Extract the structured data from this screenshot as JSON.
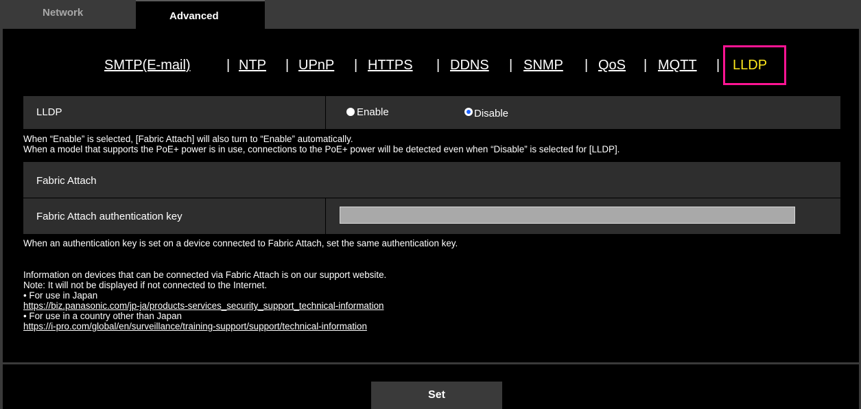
{
  "tabs": {
    "network": "Network",
    "advanced": "Advanced"
  },
  "subnav": {
    "items": [
      "SMTP(E-mail)",
      "NTP",
      "UPnP",
      "HTTPS",
      "DDNS",
      "SNMP",
      "QoS",
      "MQTT",
      "LLDP"
    ],
    "separator": "|",
    "active": "LLDP"
  },
  "lldp": {
    "label": "LLDP",
    "enable": "Enable",
    "disable": "Disable",
    "selected": "Disable"
  },
  "notes": {
    "line1": "When “Enable” is selected, [Fabric Attach] will also turn to “Enable” automatically.",
    "line2": "When a model that supports the PoE+ power is in use, connections to the PoE+ power will be detected even when “Disable” is selected for [LLDP]."
  },
  "fabric": {
    "section_title": "Fabric Attach",
    "key_label": "Fabric Attach authentication key",
    "key_value": "",
    "key_note": "When an authentication key is set on a device connected to Fabric Attach, set the same authentication key."
  },
  "info": {
    "line1": "Information on devices that can be connected via Fabric Attach is on our support website.",
    "line2": "Note: It will not be displayed if not connected to the Internet.",
    "japan_label": "• For use in Japan",
    "japan_url": "https://biz.panasonic.com/jp-ja/products-services_security_support_technical-information",
    "other_label": "• For use in a country other than Japan",
    "other_url": "https://i-pro.com/global/en/surveillance/training-support/support/technical-information"
  },
  "set_button": "Set",
  "colors": {
    "accent_active": "#ffe81c",
    "highlight_box": "#ff1493",
    "radio_selected": "#1e64ff"
  }
}
